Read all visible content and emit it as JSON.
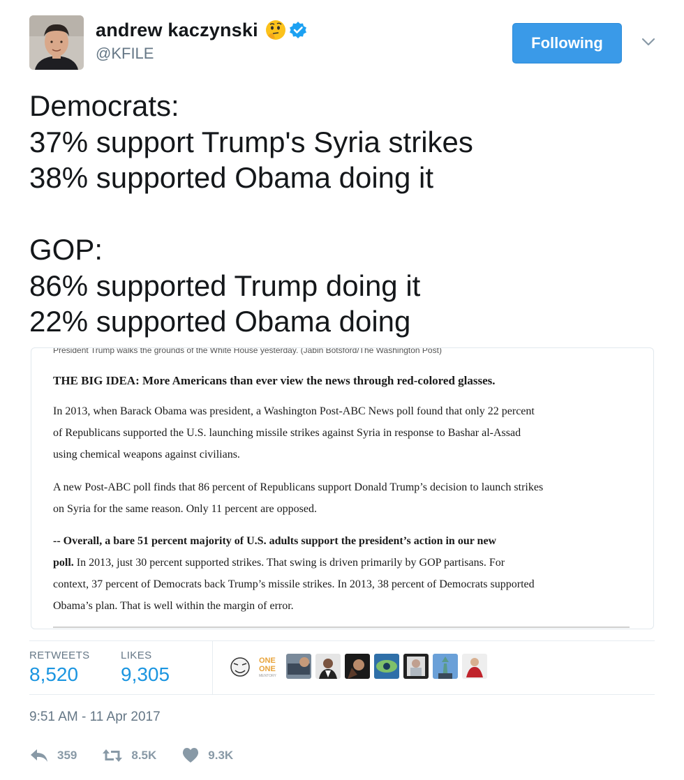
{
  "author": {
    "display_name": "andrew kaczynski",
    "handle": "@KFILE",
    "emoji": "thinking-face-icon",
    "verified_icon": "verified-badge-icon"
  },
  "follow_button": {
    "label": "Following"
  },
  "tweet": {
    "lines": [
      "Democrats:",
      "37% support Trump's Syria strikes",
      "38% supported Obama doing it",
      "",
      "GOP:",
      "86% supported Trump doing it",
      "22% supported Obama doing"
    ]
  },
  "card": {
    "caption": "President Trump walks the grounds of the White House yesterday. (Jabin Botsford/The Washington Post)",
    "heading": "THE BIG IDEA: More Americans than ever view the news through red-colored glasses.",
    "para1": [
      "In 2013, when Barack Obama was president, a Washington Post-ABC News poll found that only 22 percent",
      "of Republicans supported the U.S. launching missile strikes against Syria in response to Bashar al-Assad",
      "using chemical weapons against civilians."
    ],
    "para2": [
      "A new Post-ABC poll finds that 86 percent of Republicans support Donald Trump’s decision to launch strikes",
      "on Syria for the same reason. Only 11 percent are opposed."
    ],
    "para3_bold_1": "-- Overall, a bare 51 percent majority of U.S. adults support the president’s action in our new",
    "para3_bold_2": "poll.",
    "para3_rest_2": " In 2013, just 30 percent supported strikes. That swing is driven primarily by GOP partisans. For",
    "para3_line3": "context, 37 percent of Democrats back Trump’s missile strikes. In 2013, 38 percent of Democrats supported",
    "para3_line4": "Obama’s plan. That is well within the margin of error."
  },
  "stats": {
    "retweets_label": "RETWEETS",
    "retweets_value": "8,520",
    "likes_label": "LIKES",
    "likes_value": "9,305",
    "liker_logo_text": [
      "ONE",
      "ONE",
      "MENTORY"
    ]
  },
  "timestamp": "9:51 AM - 11 Apr 2017",
  "actions": {
    "reply_count": "359",
    "retweet_count": "8.5K",
    "like_count": "9.3K"
  },
  "colors": {
    "follow_button": "#3a9ae8",
    "link_blue": "#1b95e0",
    "muted_gray": "#657786"
  }
}
